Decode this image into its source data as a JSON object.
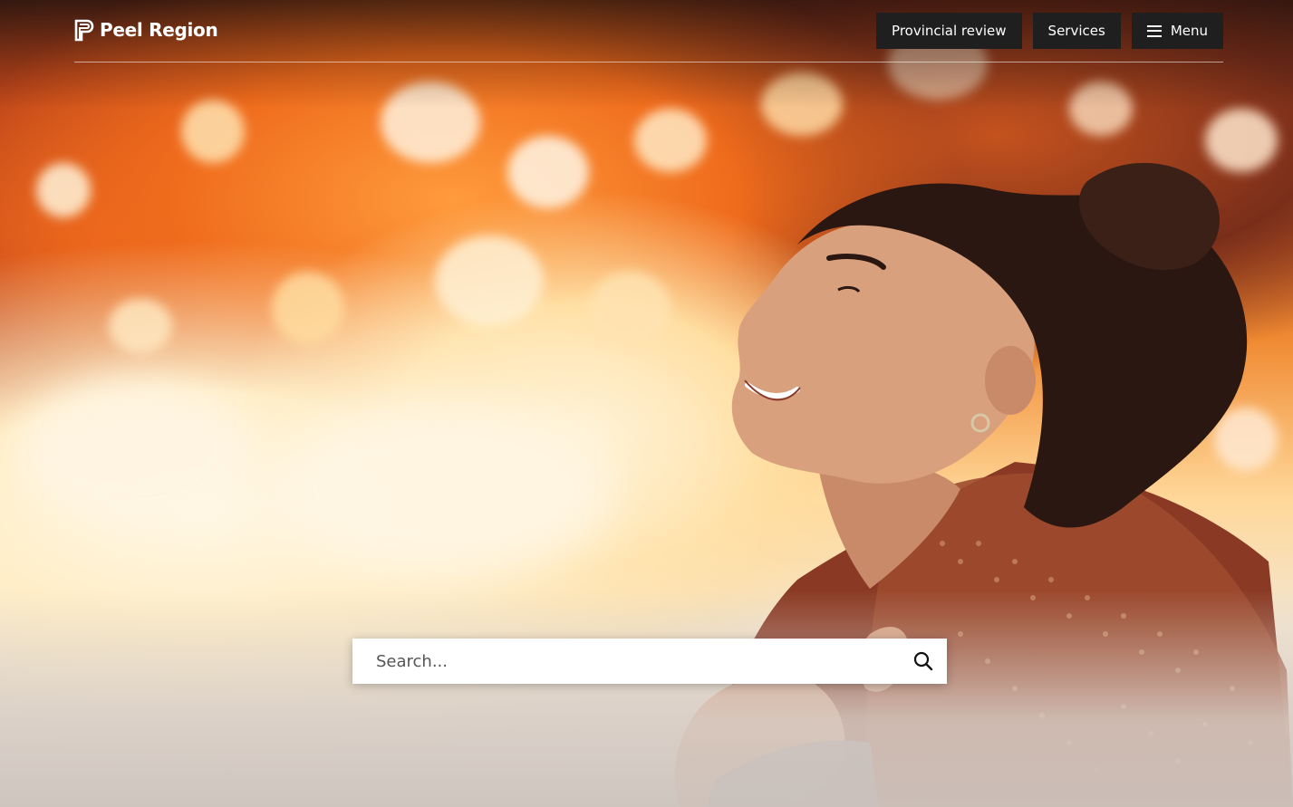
{
  "brand": {
    "name": "Peel Region",
    "logo_icon": "peel-region-logo-icon"
  },
  "nav": {
    "provincial_review_label": "Provincial review",
    "services_label": "Services",
    "menu_label": "Menu",
    "menu_icon": "hamburger-menu-icon"
  },
  "search": {
    "placeholder": "Search...",
    "value": "",
    "icon": "search-icon"
  },
  "hero": {
    "image_subject": "woman smiling under autumn leaves"
  },
  "colors": {
    "nav_button_bg": "#1f1f1f",
    "nav_text": "#ffffff",
    "search_bg": "#ffffff"
  }
}
